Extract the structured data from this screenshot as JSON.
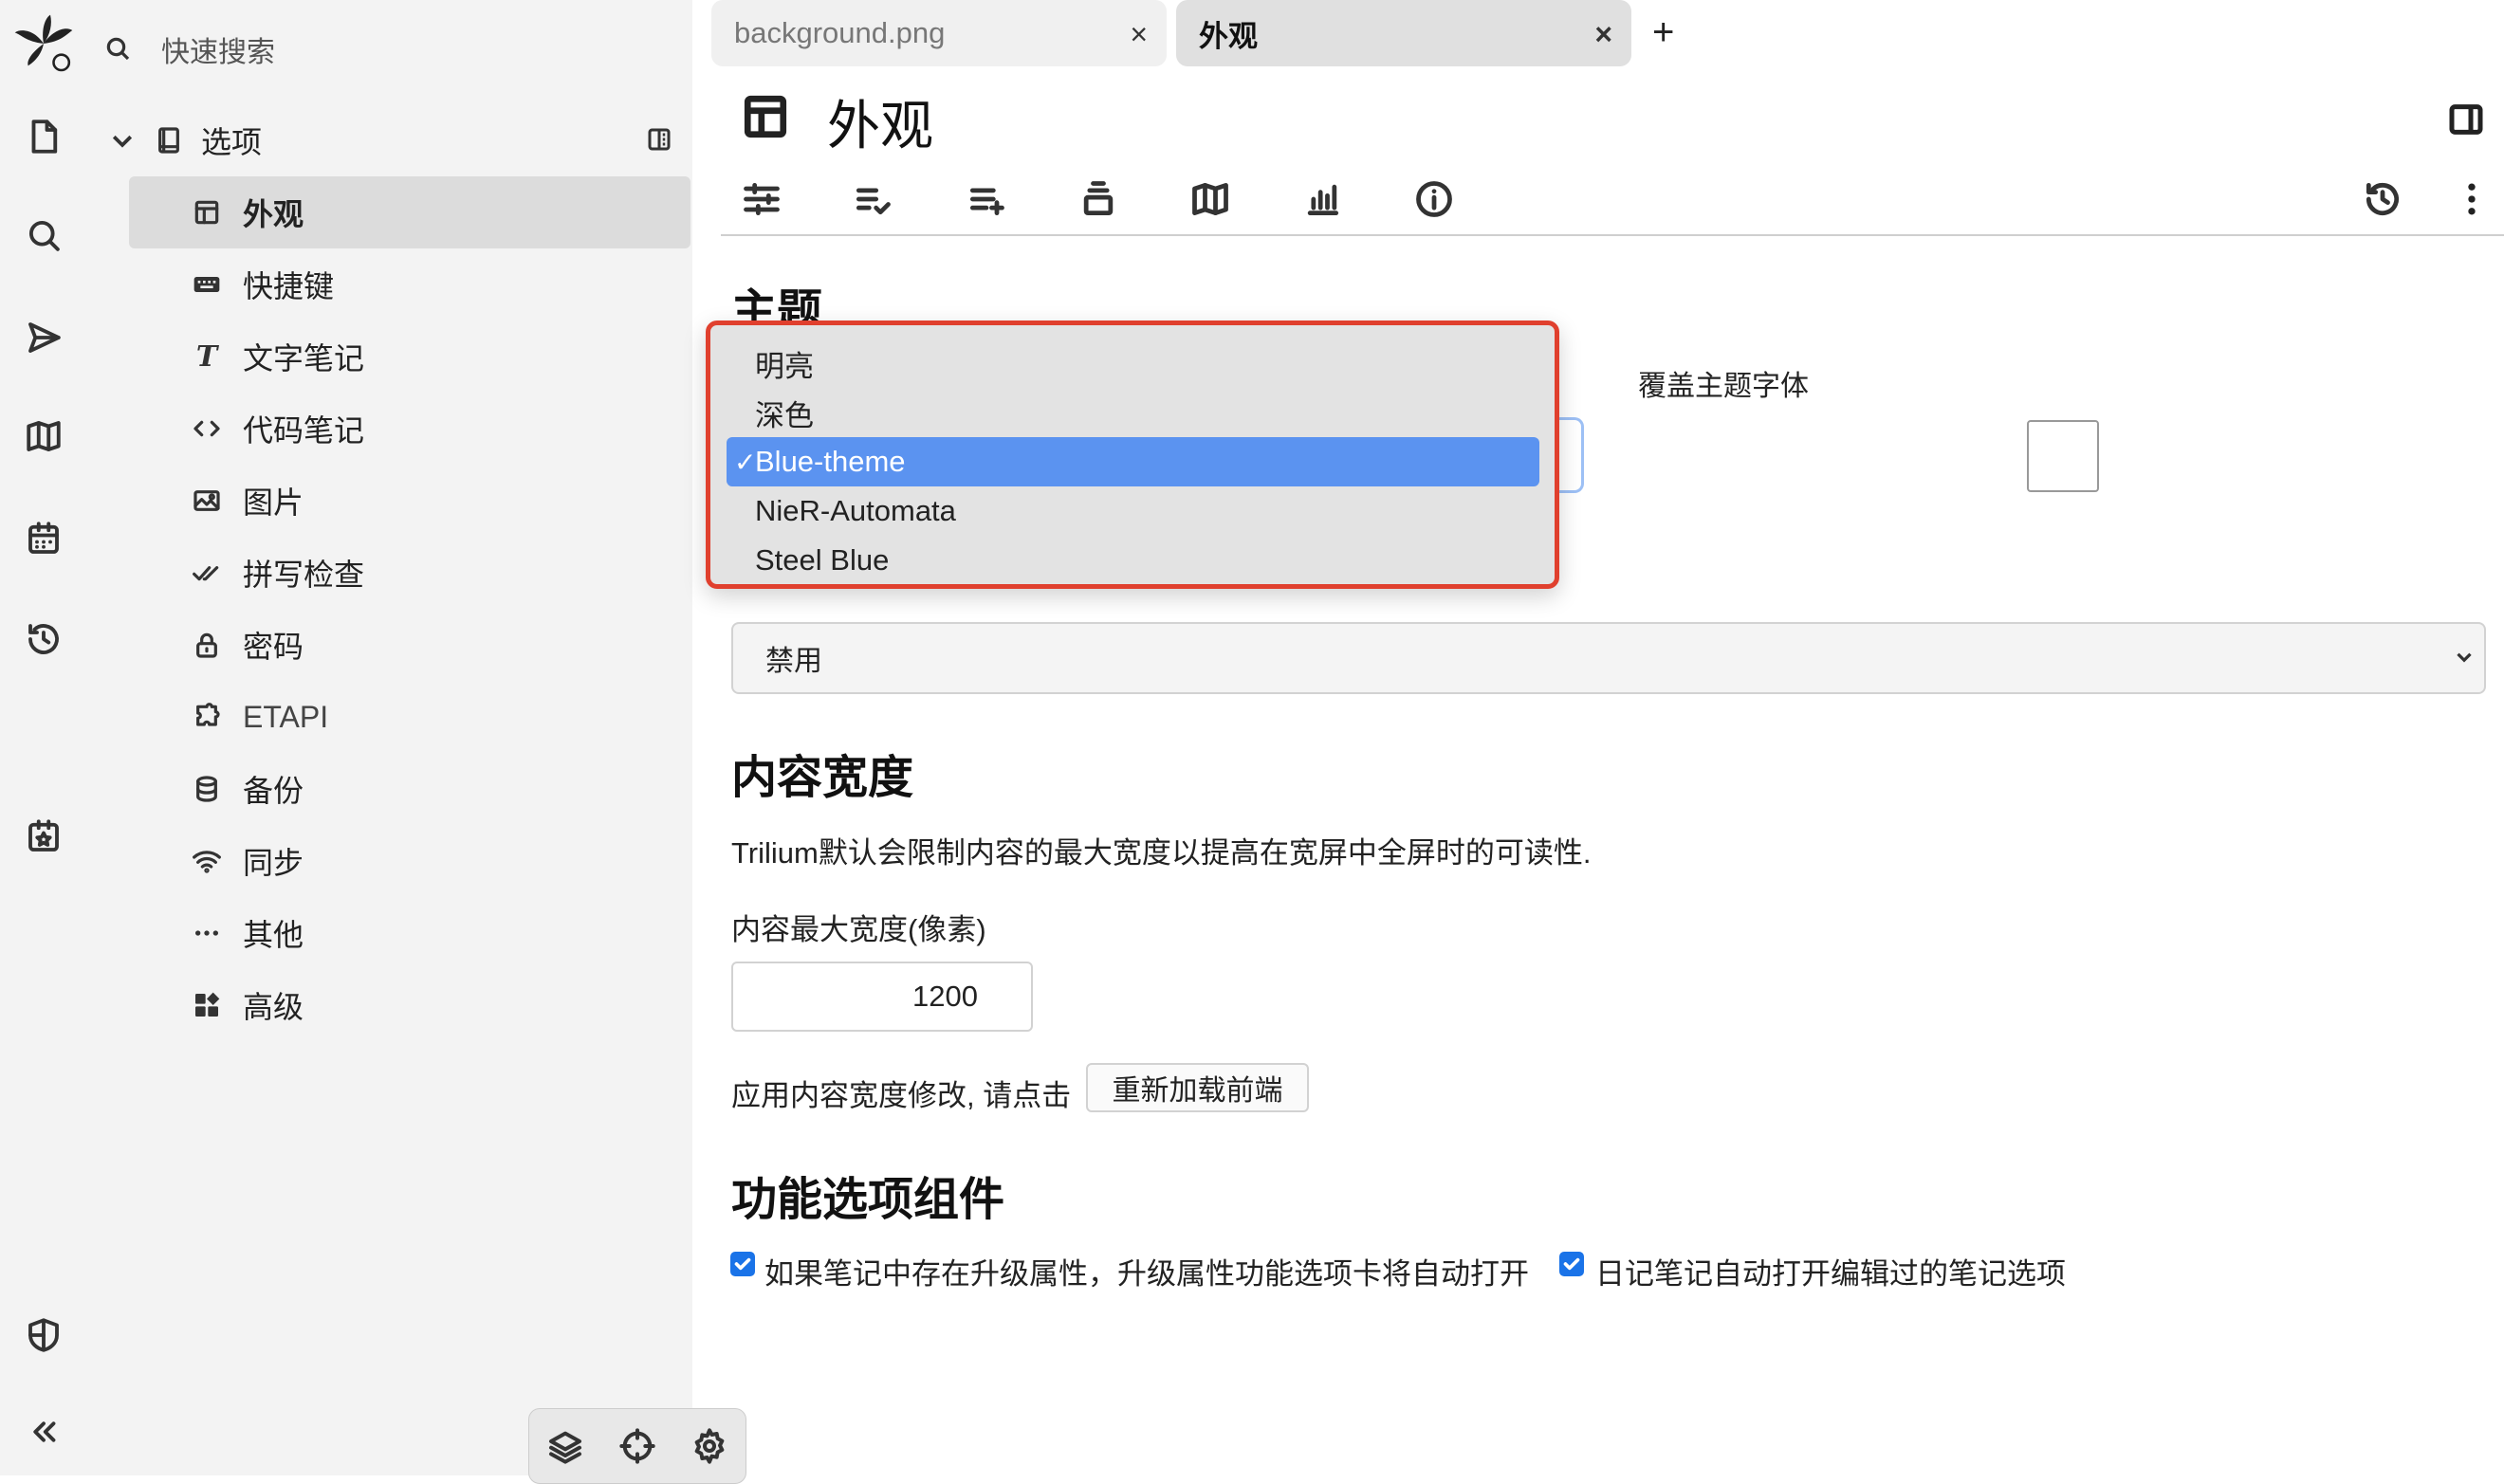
{
  "sidebar": {
    "search_placeholder": "快速搜索",
    "root_label": "选项",
    "items": [
      {
        "label": "外观",
        "icon": "layout-icon"
      },
      {
        "label": "快捷键",
        "icon": "keyboard-icon"
      },
      {
        "label": "文字笔记",
        "icon": "text-icon"
      },
      {
        "label": "代码笔记",
        "icon": "code-icon"
      },
      {
        "label": "图片",
        "icon": "image-icon"
      },
      {
        "label": "拼写检查",
        "icon": "spellcheck-icon"
      },
      {
        "label": "密码",
        "icon": "lock-icon"
      },
      {
        "label": "ETAPI",
        "icon": "puzzle-icon"
      },
      {
        "label": "备份",
        "icon": "database-icon"
      },
      {
        "label": "同步",
        "icon": "wifi-icon"
      },
      {
        "label": "其他",
        "icon": "more-icon"
      },
      {
        "label": "高级",
        "icon": "widgets-icon"
      }
    ]
  },
  "tabs": [
    {
      "label": "background.png"
    },
    {
      "label": "外观"
    }
  ],
  "page": {
    "title": "外观"
  },
  "content": {
    "theme_heading": "主题",
    "override_font_label": "覆盖主题字体",
    "disable_select_value": "禁用",
    "content_width_heading": "内容宽度",
    "content_width_desc": "Trilium默认会限制内容的最大宽度以提高在宽屏中全屏时的可读性.",
    "max_width_label": "内容最大宽度(像素)",
    "max_width_value": "1200",
    "apply_text": "应用内容宽度修改, 请点击",
    "reload_button": "重新加载前端",
    "ribbon_heading": "功能选项组件",
    "checkbox1_label": "如果笔记中存在升级属性，升级属性功能选项卡将自动打开",
    "checkbox2_label": "日记笔记自动打开编辑过的笔记选项"
  },
  "theme_dropdown": {
    "options": [
      "明亮",
      "深色",
      "Blue-theme",
      "NieR-Automata",
      "Steel Blue"
    ],
    "selected_index": 2,
    "check_mark": "✓"
  },
  "colors": {
    "selection": "#5b93f0",
    "highlight_border": "#e0402e",
    "checkbox": "#1a73e8",
    "sidebar_bg": "#f3f3f3"
  }
}
